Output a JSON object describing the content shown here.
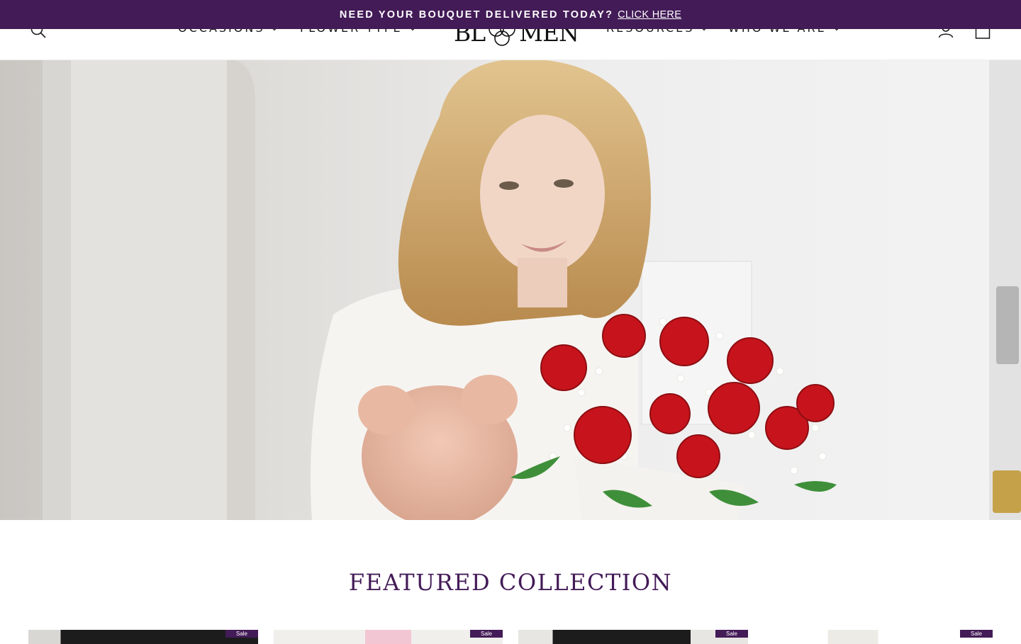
{
  "announcement": {
    "text": "NEED YOUR BOUQUET DELIVERED TODAY?",
    "link_label": "CLICK HERE"
  },
  "header": {
    "nav_left": [
      {
        "label": "OCCASIONS"
      },
      {
        "label": "FLOWER TYPE"
      }
    ],
    "logo": {
      "left": "BL",
      "right": "MEN"
    },
    "nav_right": [
      {
        "label": "RESOURCES"
      },
      {
        "label": "WHO WE ARE"
      }
    ],
    "icons": [
      "search-icon",
      "account-icon",
      "cart-icon"
    ]
  },
  "hero": {
    "image": "woman-holding-red-roses-and-teddy-bear"
  },
  "featured": {
    "title": "FEATURED COLLECTION",
    "cards": [
      {
        "badge": "Sale"
      },
      {
        "badge": "Sale"
      },
      {
        "badge": "Sale"
      },
      {
        "badge": "Sale"
      }
    ]
  },
  "colors": {
    "brand_purple": "#431b57",
    "text": "#1a1a1a",
    "background": "#ffffff"
  }
}
